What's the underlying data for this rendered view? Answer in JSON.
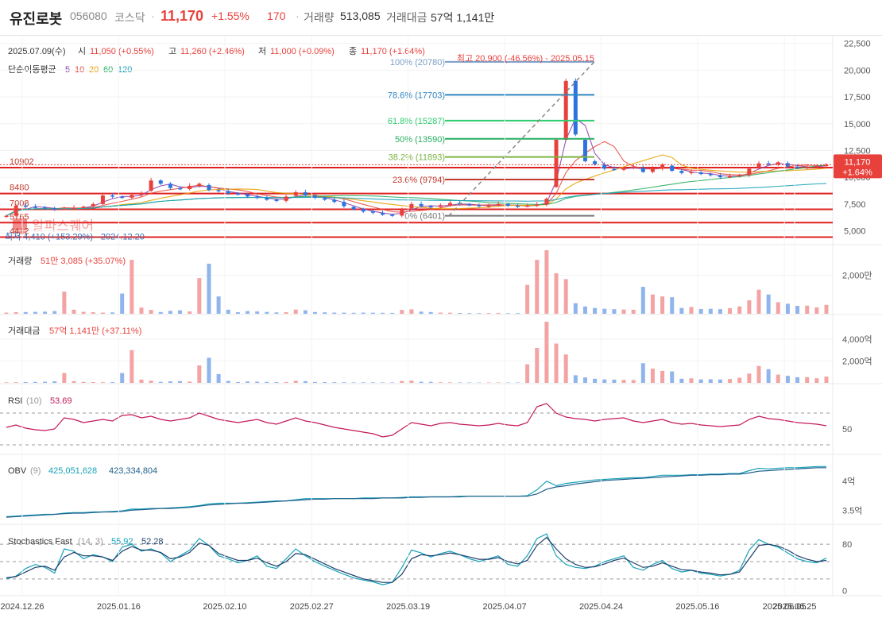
{
  "header": {
    "name": "유진로봇",
    "code": "056080",
    "market": "코스닥",
    "price": "11,170",
    "change_pct": "+1.55%",
    "change_abs": "170",
    "volume_label": "거래량",
    "volume": "513,085",
    "amount_label": "거래대금",
    "amount": "57억 1,141만"
  },
  "ohlc_line": {
    "date": "2025.07.09(수)",
    "open_label": "시",
    "open": "11,050 (+0.55%)",
    "high_label": "고",
    "high": "11,260 (+2.46%)",
    "low_label": "저",
    "low": "11,000 (+0.09%)",
    "close_label": "종",
    "close": "11,170 (+1.64%)"
  },
  "ma_legend": {
    "label": "단순이동평균",
    "periods": [
      "5",
      "10",
      "20",
      "60",
      "120"
    ],
    "colors": [
      "#8e44ad",
      "#e74c3c",
      "#e6a100",
      "#27ae60",
      "#17a2b8"
    ]
  },
  "watermark": "알파스퀘어",
  "colors": {
    "up": "#e8413c",
    "down": "#2c73e0",
    "fib": "#7a9cc6"
  },
  "chart_data": [
    {
      "type": "candlestick",
      "title": "유진로봇",
      "xlabel": "",
      "ylabel": "",
      "x_ticks": [
        "2024.12.26",
        "2025.01.16",
        "2025.02.10",
        "2025.02.27",
        "2025.03.19",
        "2025.04.07",
        "2025.04.24",
        "2025.05.16",
        "2025.06.05",
        "2025.06.25"
      ],
      "y_ticks": [
        "5,000",
        "7,500",
        "10,000",
        "12,500",
        "15,000",
        "17,500",
        "20,000",
        "22,500"
      ],
      "ylim": [
        4300,
        22700
      ],
      "last_price_tag": [
        "11,170",
        "+1.64%"
      ],
      "horizontal_lines": [
        {
          "label": "10902",
          "value": 10902
        },
        {
          "label": "8480",
          "value": 8480
        },
        {
          "label": "7008",
          "value": 7008
        },
        {
          "label": "5765",
          "value": 5765
        },
        {
          "label": "4412",
          "value": 4412
        }
      ],
      "fibonacci": [
        {
          "label": "100% (20780)",
          "value": 20780
        },
        {
          "label": "78.6% (17703)",
          "value": 17703
        },
        {
          "label": "61.8% (15287)",
          "value": 15287
        },
        {
          "label": "50% (13590)",
          "value": 13590
        },
        {
          "label": "38.2% (11893)",
          "value": 11893
        },
        {
          "label": "23.6% (9794)",
          "value": 9794
        },
        {
          "label": "0% (6401)",
          "value": 6401
        }
      ],
      "annotations": [
        {
          "text": "최고 20,900 (-46.56%) - 2025.05.15"
        },
        {
          "text": "최저 4,410 (+153.29%) - 2024.12.20"
        }
      ],
      "close_anchors": [
        6400,
        7350,
        7250,
        7200,
        7100,
        7000,
        7050,
        7150,
        7250,
        7500,
        8300,
        8200,
        8100,
        8350,
        8500,
        9700,
        9400,
        9000,
        8900,
        9200,
        9400,
        8800,
        8700,
        8500,
        8400,
        8200,
        8100,
        7900,
        7800,
        8200,
        8600,
        8300,
        8100,
        7900,
        7700,
        7300,
        7000,
        6800,
        6700,
        6500,
        6420,
        7000,
        7500,
        7300,
        7200,
        7400,
        7600,
        7500,
        7400,
        7300,
        7350,
        7500,
        7350,
        7300,
        7350,
        7450,
        8000,
        13500,
        19000,
        14000,
        11500,
        11200,
        10800,
        10700,
        10900,
        11000,
        10500,
        10800,
        11200,
        10600,
        10400,
        10500,
        10300,
        10200,
        10000,
        10100,
        10200,
        10800,
        11300,
        11200,
        11400,
        11000,
        10900,
        11000,
        11050,
        11170
      ]
    },
    {
      "type": "bar",
      "title": "거래량",
      "series": [
        {
          "name": "거래량",
          "values": [
            60,
            80,
            90,
            100,
            110,
            140,
            1150,
            210,
            100,
            80,
            60,
            70,
            1050,
            2800,
            320,
            200,
            90,
            150,
            180,
            120,
            1850,
            2600,
            900,
            210,
            80,
            140,
            120,
            95,
            70,
            80,
            220,
            180,
            90,
            75,
            60,
            60,
            50,
            60,
            55,
            50,
            45,
            200,
            230,
            110,
            90,
            60,
            55,
            40,
            35,
            30,
            35,
            40,
            30,
            35,
            1500,
            2800,
            3300,
            2100,
            1800,
            550,
            380,
            300,
            260,
            240,
            220,
            210,
            1400,
            1000,
            900,
            860,
            300,
            350,
            250,
            260,
            240,
            290,
            380,
            700,
            1250,
            1000,
            600,
            520,
            410,
            420,
            330,
            460
          ]
        }
      ],
      "readout": "51만 3,085 (+35.07%)",
      "y_ticks": [
        "2,000만"
      ]
    },
    {
      "type": "bar",
      "title": "거래대금",
      "series": [
        {
          "name": "거래대금",
          "values": [
            50,
            60,
            70,
            90,
            100,
            140,
            900,
            160,
            90,
            70,
            60,
            70,
            900,
            3000,
            300,
            200,
            90,
            140,
            160,
            120,
            1600,
            2300,
            800,
            180,
            70,
            130,
            110,
            90,
            70,
            80,
            200,
            160,
            80,
            70,
            60,
            55,
            45,
            50,
            50,
            40,
            40,
            180,
            210,
            100,
            90,
            55,
            50,
            40,
            35,
            30,
            35,
            40,
            30,
            35,
            1700,
            3200,
            5600,
            3600,
            2600,
            700,
            500,
            380,
            320,
            300,
            270,
            260,
            1800,
            1300,
            1100,
            1050,
            380,
            420,
            320,
            330,
            310,
            360,
            470,
            850,
            1550,
            1250,
            760,
            650,
            520,
            530,
            420,
            571
          ]
        }
      ],
      "readout": "57억 1,141만 (+37.11%)",
      "y_ticks": [
        "4,000억",
        "2,000억"
      ]
    },
    {
      "type": "line",
      "title": "RSI",
      "param": "(10)",
      "readout": "53.69",
      "y_ticks": [
        "50"
      ],
      "series": [
        {
          "name": "RSI",
          "values": [
            52,
            55,
            51,
            49,
            48,
            50,
            64,
            62,
            58,
            60,
            62,
            60,
            67,
            68,
            64,
            66,
            62,
            60,
            62,
            64,
            70,
            66,
            62,
            60,
            58,
            60,
            62,
            58,
            56,
            60,
            64,
            60,
            58,
            55,
            52,
            50,
            48,
            46,
            44,
            40,
            42,
            50,
            58,
            56,
            54,
            57,
            58,
            56,
            55,
            54,
            55,
            57,
            55,
            54,
            58,
            78,
            82,
            70,
            65,
            63,
            62,
            60,
            62,
            63,
            64,
            60,
            58,
            60,
            62,
            58,
            56,
            57,
            55,
            54,
            53,
            54,
            55,
            62,
            66,
            63,
            62,
            60,
            58,
            57,
            56,
            54
          ]
        }
      ]
    },
    {
      "type": "line",
      "title": "OBV",
      "param": "(9)",
      "readout": [
        "425,051,628",
        "423,334,804"
      ],
      "y_ticks": [
        "4억",
        "3.5억"
      ],
      "series": [
        {
          "name": "OBV",
          "values": [
            339,
            340,
            341,
            342,
            343,
            343,
            345,
            346,
            346,
            347,
            347,
            348,
            349,
            352,
            352,
            353,
            353,
            354,
            355,
            356,
            358,
            361,
            362,
            362,
            362,
            363,
            364,
            365,
            366,
            366,
            368,
            370,
            370,
            370,
            370,
            370,
            370,
            371,
            371,
            371,
            371,
            372,
            373,
            373,
            373,
            373,
            373,
            374,
            374,
            374,
            374,
            374,
            374,
            374,
            375,
            385,
            400,
            392,
            396,
            398,
            400,
            402,
            403,
            404,
            405,
            406,
            406,
            408,
            410,
            410,
            410,
            411,
            411,
            412,
            412,
            413,
            413,
            418,
            422,
            421,
            422,
            423,
            423,
            424,
            425,
            425
          ]
        },
        {
          "name": "OBV signal",
          "values": [
            338,
            339,
            340,
            341,
            342,
            343,
            344,
            345,
            345,
            346,
            347,
            347,
            348,
            350,
            351,
            352,
            353,
            353,
            354,
            355,
            357,
            359,
            360,
            361,
            362,
            362,
            363,
            364,
            365,
            366,
            367,
            368,
            369,
            369,
            370,
            370,
            370,
            370,
            370,
            371,
            371,
            371,
            372,
            372,
            373,
            373,
            373,
            373,
            374,
            374,
            374,
            374,
            374,
            374,
            374,
            378,
            386,
            390,
            392,
            395,
            397,
            399,
            401,
            402,
            403,
            404,
            405,
            406,
            407,
            408,
            409,
            410,
            410,
            411,
            411,
            412,
            412,
            414,
            417,
            418,
            419,
            420,
            421,
            422,
            423,
            423
          ]
        }
      ]
    },
    {
      "type": "line",
      "title": "Stochastics Fast",
      "param": "(14, 3)",
      "readout": [
        "55.92",
        "52.28"
      ],
      "y_ticks": [
        "80",
        "0"
      ],
      "series": [
        {
          "name": "%K",
          "values": [
            20,
            25,
            38,
            45,
            40,
            30,
            72,
            68,
            55,
            62,
            58,
            50,
            75,
            80,
            68,
            72,
            65,
            50,
            60,
            70,
            90,
            78,
            60,
            55,
            48,
            52,
            60,
            42,
            38,
            55,
            72,
            60,
            50,
            42,
            35,
            28,
            22,
            18,
            15,
            10,
            14,
            40,
            70,
            65,
            58,
            64,
            68,
            62,
            55,
            50,
            55,
            60,
            45,
            42,
            60,
            90,
            98,
            60,
            45,
            40,
            38,
            42,
            50,
            55,
            60,
            40,
            35,
            45,
            52,
            38,
            32,
            35,
            30,
            28,
            25,
            28,
            35,
            70,
            88,
            80,
            75,
            65,
            55,
            50,
            48,
            56
          ]
        },
        {
          "name": "%D",
          "values": [
            22,
            24,
            32,
            40,
            42,
            35,
            58,
            66,
            60,
            60,
            58,
            52,
            68,
            76,
            70,
            70,
            66,
            55,
            58,
            66,
            82,
            78,
            64,
            58,
            52,
            52,
            56,
            48,
            42,
            50,
            64,
            62,
            54,
            46,
            38,
            32,
            26,
            20,
            17,
            14,
            14,
            28,
            55,
            62,
            60,
            62,
            65,
            62,
            58,
            54,
            54,
            57,
            50,
            46,
            52,
            78,
            92,
            72,
            55,
            45,
            40,
            41,
            46,
            52,
            56,
            48,
            40,
            42,
            48,
            42,
            36,
            35,
            32,
            30,
            27,
            28,
            32,
            55,
            78,
            80,
            77,
            70,
            60,
            54,
            50,
            52
          ]
        }
      ]
    }
  ]
}
